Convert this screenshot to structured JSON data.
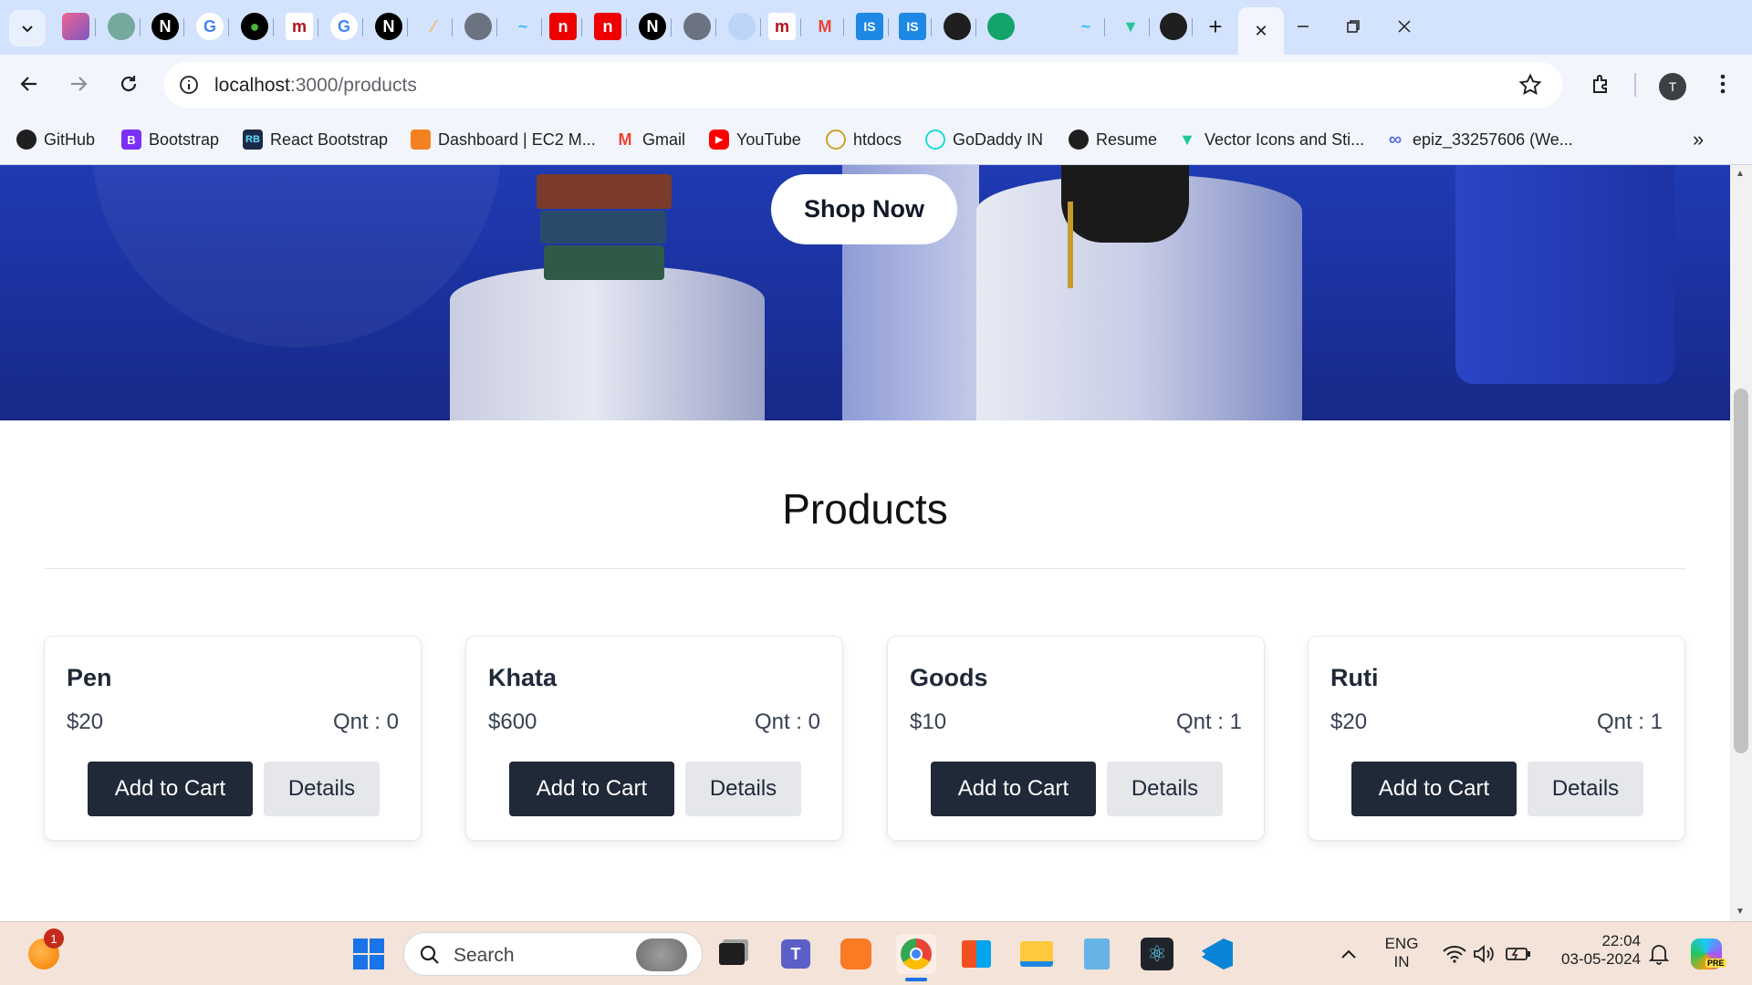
{
  "browser": {
    "bookmarks": [
      {
        "label": "GitHub",
        "icon": "github-icon",
        "color": "#1f1f1f"
      },
      {
        "label": "Bootstrap",
        "icon": "bootstrap-icon",
        "color": "#7b2ff7"
      },
      {
        "label": "React Bootstrap",
        "icon": "react-bootstrap-icon",
        "color": "#3b5ba5"
      },
      {
        "label": "Dashboard | EC2 M...",
        "icon": "aws-cube-icon",
        "color": "#f4811f"
      },
      {
        "label": "Gmail",
        "icon": "gmail-icon",
        "color": "#ea4335"
      },
      {
        "label": "YouTube",
        "icon": "youtube-icon",
        "color": "#ff0000"
      },
      {
        "label": "htdocs",
        "icon": "htdocs-icon",
        "color": "#c9a227"
      },
      {
        "label": "GoDaddy IN",
        "icon": "godaddy-icon",
        "color": "#1bdbdb"
      },
      {
        "label": "Resume",
        "icon": "globe-icon",
        "color": "#1f1f1f"
      },
      {
        "label": "Vector Icons and Sti...",
        "icon": "vector-icon",
        "color": "#20c997"
      },
      {
        "label": "epiz_33257606 (We...",
        "icon": "infinity-icon",
        "color": "#5b6ee1"
      }
    ],
    "address": {
      "host": "localhost",
      "path": ":3000/products"
    },
    "profile_initial": "T",
    "close_tab_glyph": "✕",
    "new_tab_glyph": "+"
  },
  "page": {
    "hero_button": "Shop Now",
    "section_title": "Products",
    "products": [
      {
        "name": "Pen",
        "price": "$20",
        "qty": "Qnt : 0",
        "cart_label": "Add to Cart",
        "details_label": "Details"
      },
      {
        "name": "Khata",
        "price": "$600",
        "qty": "Qnt : 0",
        "cart_label": "Add to Cart",
        "details_label": "Details"
      },
      {
        "name": "Goods",
        "price": "$10",
        "qty": "Qnt : 1",
        "cart_label": "Add to Cart",
        "details_label": "Details"
      },
      {
        "name": "Ruti",
        "price": "$20",
        "qty": "Qnt : 1",
        "cart_label": "Add to Cart",
        "details_label": "Details"
      }
    ]
  },
  "taskbar": {
    "search_placeholder": "Search",
    "notification_count": "1",
    "lang_line1": "ENG",
    "lang_line2": "IN",
    "time": "22:04",
    "date": "03-05-2024",
    "copilot_badge": "PRE"
  },
  "colors": {
    "hero": "#1f3bb3",
    "button_dark": "#1f2937",
    "button_light": "#e5e7eb",
    "tabstrip": "#d3e3fd"
  }
}
